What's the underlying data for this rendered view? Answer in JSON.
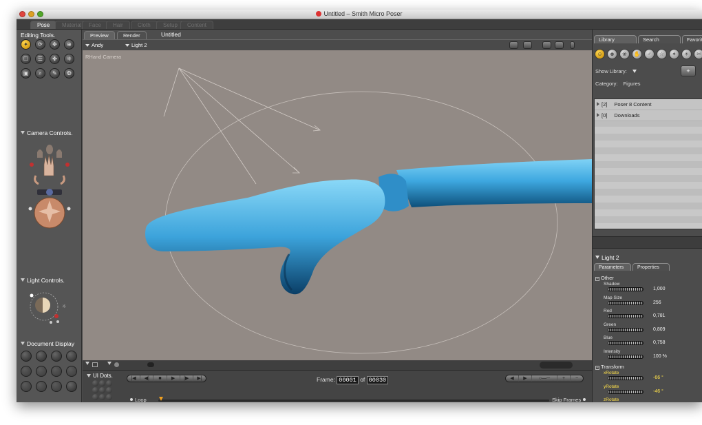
{
  "window": {
    "title": "Untitled – Smith Micro Poser"
  },
  "rooms": [
    "Pose",
    "Material",
    "Face",
    "Hair",
    "Cloth",
    "Setup",
    "Content"
  ],
  "left": {
    "editing_title": "Editing Tools.",
    "tools": [
      "✦",
      "⟳",
      "✥",
      "⊕",
      "☐",
      "☰",
      "✤",
      "❈",
      "▣",
      "⌕",
      "✎",
      "❂"
    ],
    "camera_title": "Camera Controls.",
    "light_title": "Light Controls.",
    "document_title": "Document Display"
  },
  "doc": {
    "tab_preview": "Preview",
    "tab_render": "Render",
    "name": "Untitled",
    "figure_menu": "Andy",
    "light_menu": "Light 2",
    "camera_label": "RHand Camera"
  },
  "timeline": {
    "uidots_title": "UI Dots.",
    "transport": [
      "|◀",
      "◀|",
      "■",
      "▶",
      "|▶",
      "▶|"
    ],
    "frame_label": "Frame:",
    "frame_current": "00001",
    "of_label": "of",
    "frame_total": "00030",
    "keys": [
      "◀",
      "▶",
      "○—─",
      "+",
      "−"
    ],
    "loop_label": "Loop",
    "skip_label": "Skip Frames"
  },
  "library": {
    "tabs": [
      "Library",
      "Search",
      "Favorites"
    ],
    "icons": [
      "☺",
      "☻",
      "❀",
      "✋",
      "♂",
      "☆",
      "✦",
      "☀",
      "✄"
    ],
    "show_label": "Show Library:",
    "category_label": "Category:",
    "category_value": "Figures",
    "items": [
      {
        "count": "[2]",
        "name": "Poser 8 Content"
      },
      {
        "count": "[0]",
        "name": "Downloads"
      }
    ]
  },
  "params": {
    "title": "Light 2",
    "tabs": [
      "Parameters",
      "Properties"
    ],
    "group_other": "Other",
    "group_transform": "Transform",
    "items": [
      {
        "name": "Shadow",
        "value": "1,000"
      },
      {
        "name": "Map Size",
        "value": "256"
      },
      {
        "name": "Red",
        "value": "0,781"
      },
      {
        "name": "Green",
        "value": "0,809"
      },
      {
        "name": "Blue",
        "value": "0,758"
      },
      {
        "name": "Intensity",
        "value": "100 %"
      }
    ],
    "transform": [
      {
        "name": "xRotate",
        "value": "-66 °"
      },
      {
        "name": "yRotate",
        "value": "-46 °"
      },
      {
        "name": "zRotate",
        "value": ""
      }
    ]
  },
  "colors": {
    "accent": "#ffd54d",
    "viewport": "#928a85",
    "figure": "#3ea8e0"
  }
}
